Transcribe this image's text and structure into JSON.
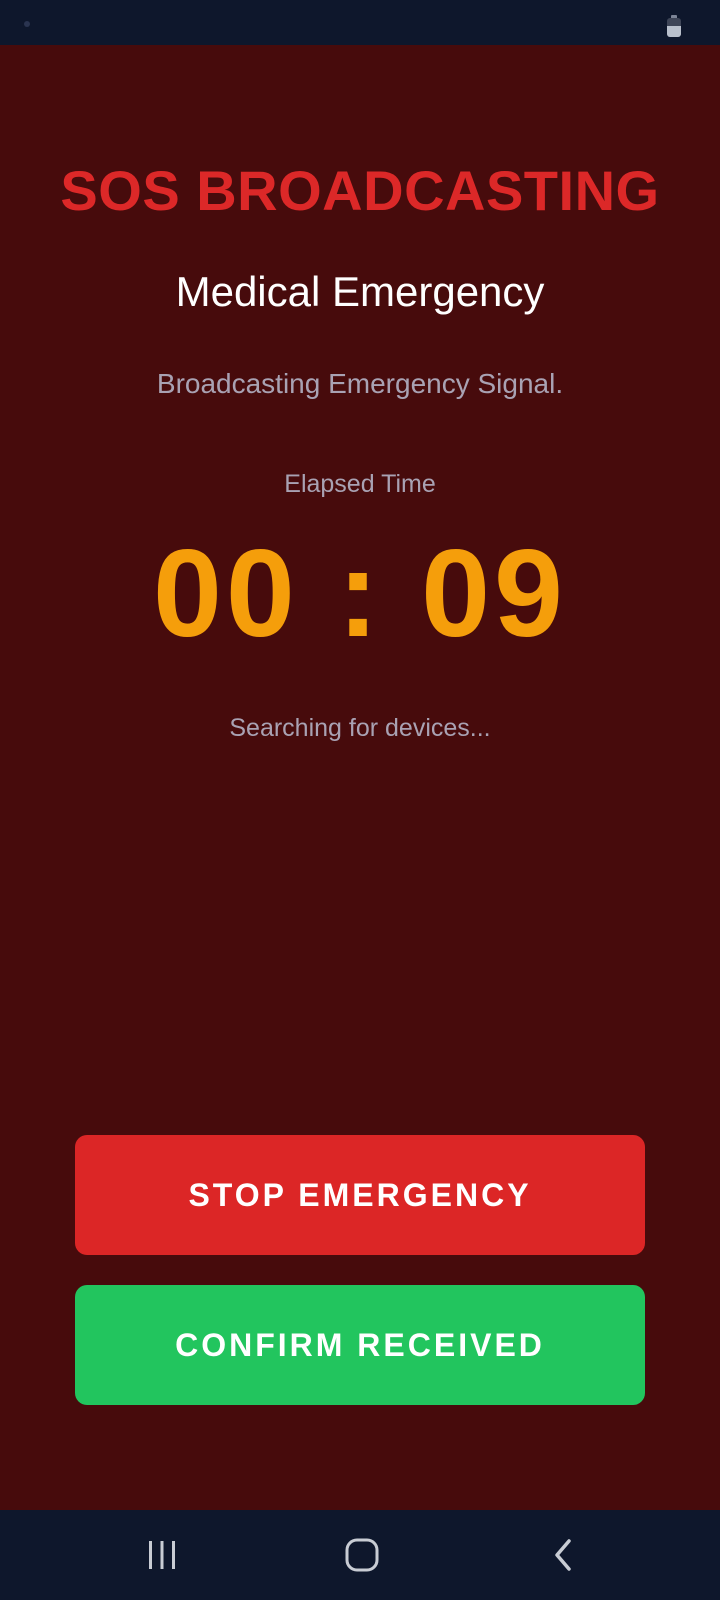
{
  "colors": {
    "background": "#470b0c",
    "title": "#dc2828",
    "timer": "#f59e0b",
    "stop_button": "#dc2626",
    "confirm_button": "#22c55e",
    "system_bars": "#0e172c"
  },
  "status_bar": {
    "icons": [
      "notification-dot-icon",
      "battery-icon"
    ]
  },
  "sos": {
    "title": "SOS BROADCASTING",
    "emergency_type": "Medical Emergency",
    "status": "Broadcasting Emergency Signal.",
    "elapsed_label": "Elapsed Time",
    "elapsed_time": "00 : 09",
    "device_status": "Searching for devices..."
  },
  "actions": {
    "stop_label": "STOP EMERGENCY",
    "confirm_label": "CONFIRM RECEIVED"
  },
  "nav_bar": {
    "icons": [
      "recent-apps-icon",
      "home-icon",
      "back-icon"
    ]
  }
}
